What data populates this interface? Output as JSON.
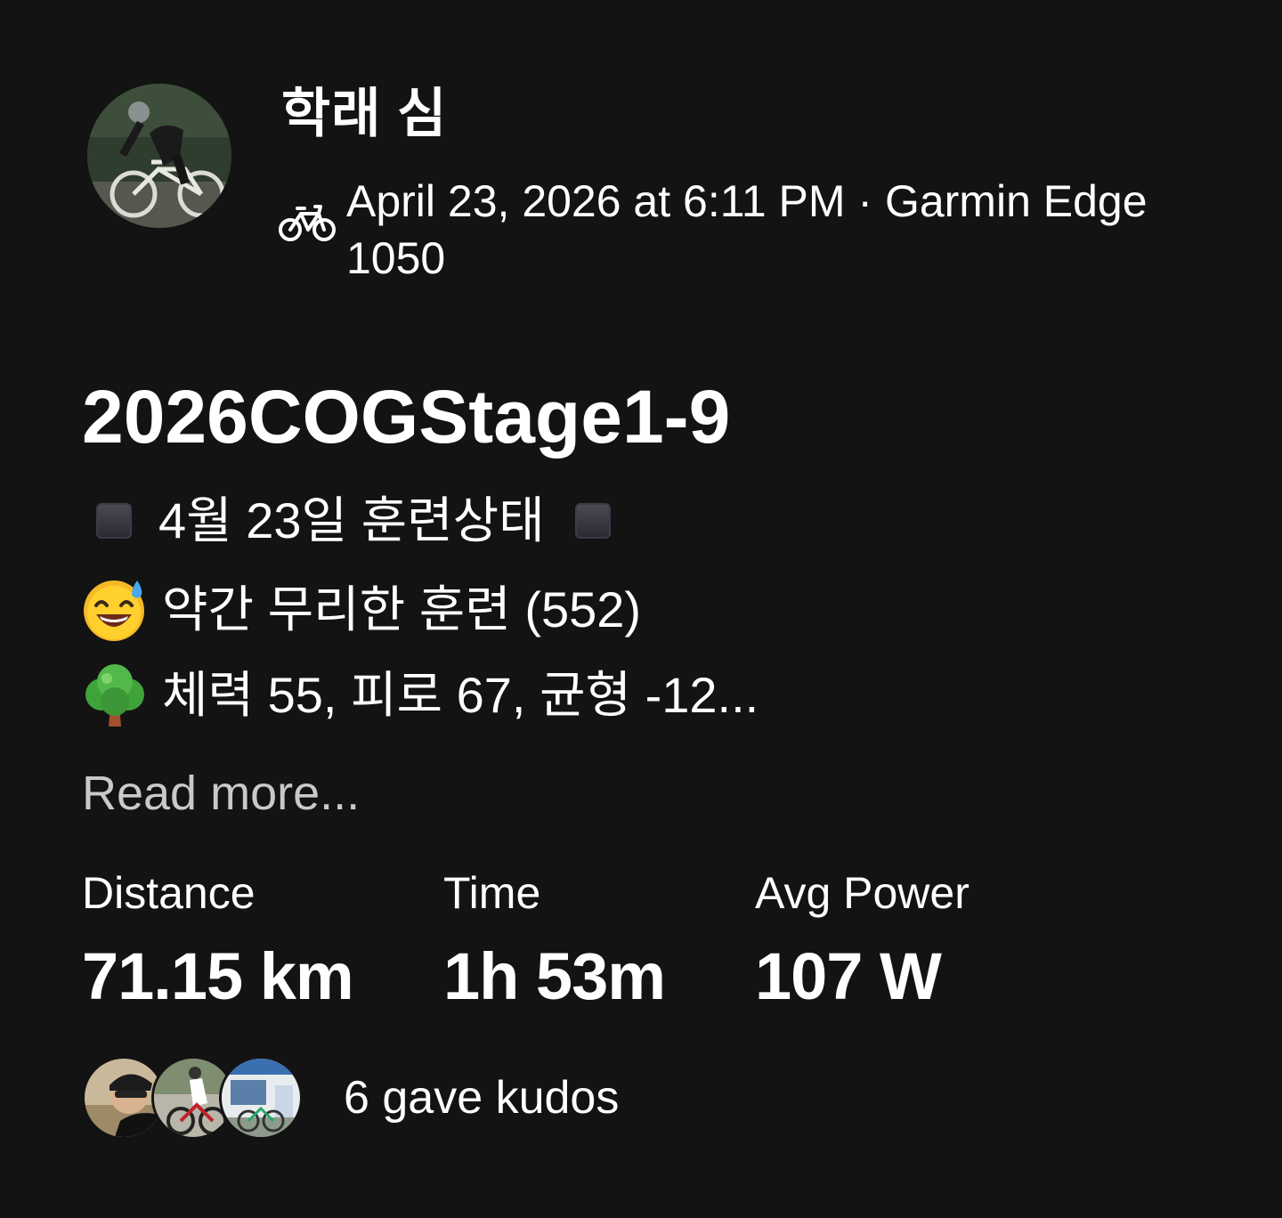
{
  "athlete": {
    "name": "학래 심",
    "avatar_icon": "avatar-cyclist-photo"
  },
  "meta": {
    "sport_icon": "bicycle-icon",
    "text": "April 23, 2026 at 6:11 PM · Garmin Edge 1050"
  },
  "activity": {
    "title": "2026COGStage1-9",
    "description": [
      {
        "icon": "black-square-icon",
        "text": "4월 23일 훈련상태",
        "trailing_icon": "black-square-icon"
      },
      {
        "icon": "sweat-smile-emoji",
        "text": "약간 무리한 훈련 (552)"
      },
      {
        "icon": "tree-emoji",
        "text": "체력 55, 피로 67, 균형 -12..."
      }
    ],
    "read_more": "Read more..."
  },
  "stats": [
    {
      "label": "Distance",
      "value": "71.15 km"
    },
    {
      "label": "Time",
      "value": "1h 53m"
    },
    {
      "label": "Avg Power",
      "value": "107 W"
    }
  ],
  "kudos": {
    "text": "6 gave kudos",
    "avatars": [
      "kudos-avatar-1",
      "kudos-avatar-2",
      "kudos-avatar-3"
    ]
  },
  "colors": {
    "background": "#131313",
    "text": "#ffffff",
    "muted_text": "#c9c9c9"
  }
}
